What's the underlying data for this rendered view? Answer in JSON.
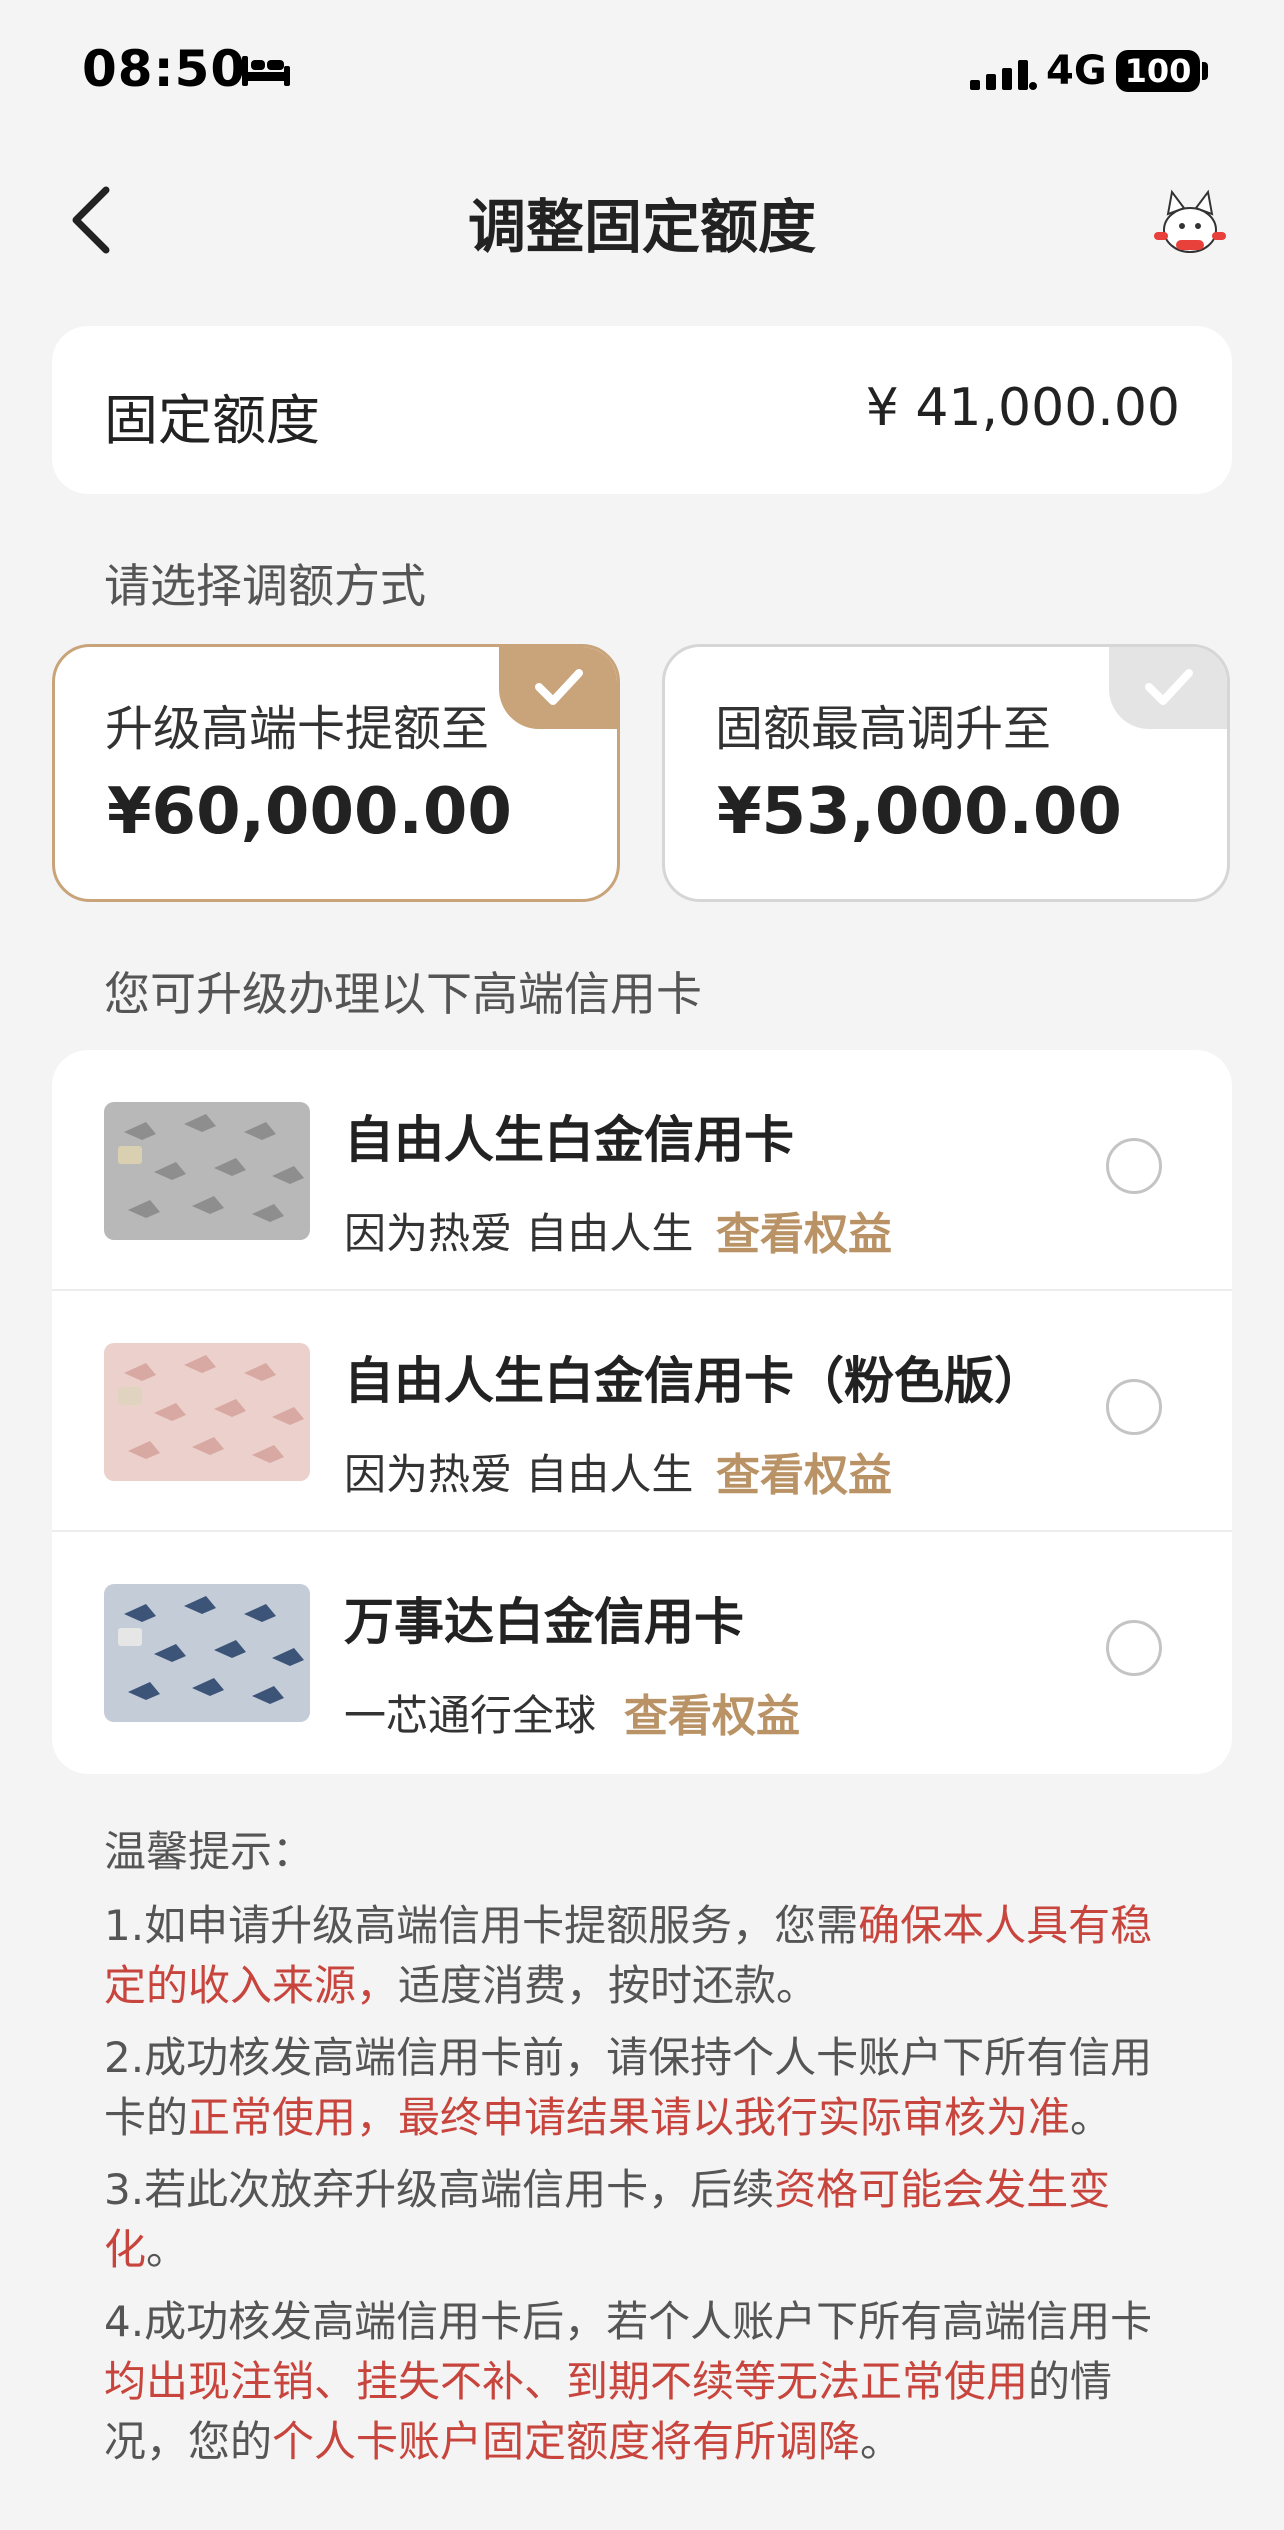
{
  "status_bar": {
    "time": "08:50",
    "network": "4G",
    "battery": "100"
  },
  "header": {
    "title": "调整固定额度"
  },
  "fixed_limit": {
    "label": "固定额度",
    "value": "¥ 41,000.00"
  },
  "options_section": {
    "label": "请选择调额方式",
    "options": [
      {
        "label": "升级高端卡提额至",
        "amount": "¥60,000.00",
        "selected": true
      },
      {
        "label": "固额最高调升至",
        "amount": "¥53,000.00",
        "selected": false
      }
    ]
  },
  "cards_section": {
    "label": "您可升级办理以下高端信用卡",
    "benefit_link": "查看权益",
    "cards": [
      {
        "name": "自由人生白金信用卡",
        "slogan": "因为热爱 自由人生"
      },
      {
        "name": "自由人生白金信用卡（粉色版）",
        "slogan": "因为热爱 自由人生"
      },
      {
        "name": "万事达白金信用卡",
        "slogan": "一芯通行全球"
      }
    ]
  },
  "tips": {
    "title": "温馨提示：",
    "items": [
      {
        "a": "1.如申请升级高端信用卡提额服务，您需",
        "b": "确保本人具有稳定的收入来源，",
        "c": "适度消费，按时还款。"
      },
      {
        "a": "2.成功核发高端信用卡前，请保持个人卡账户下所有信用卡的",
        "b": "正常使用，最终申请结果请以我行实际审核为准",
        "c": "。"
      },
      {
        "a": "3.若此次放弃升级高端信用卡，后续",
        "b": "资格可能会发生变化",
        "c": "。"
      },
      {
        "a": "4.成功核发高端信用卡后，若个人账户下所有高端信用卡",
        "b": "均出现注销、挂失不补、到期不续等无法正常使用",
        "c": "的情况，您的",
        "d": "个人卡账户固定额度将有所调降",
        "e": "。"
      }
    ]
  },
  "colors": {
    "accent_gold": "#c9a47a",
    "link_gold": "#b99366",
    "warning_red": "#c8453e",
    "background": "#f4f4f4"
  },
  "icons": {
    "back": "chevron-left-icon",
    "mascot": "cat-mascot-icon",
    "check": "check-icon",
    "sleep": "bed-icon",
    "signal": "signal-icon"
  }
}
